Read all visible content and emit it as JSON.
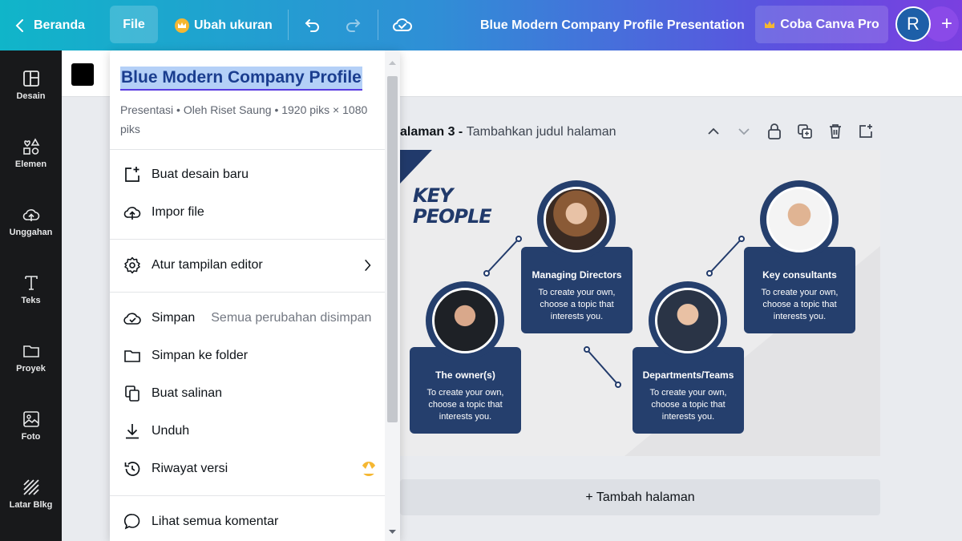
{
  "topbar": {
    "back_label": "Beranda",
    "file_label": "File",
    "resize_label": "Ubah ukuran",
    "doc_title": "Blue Modern Company Profile Presentation",
    "pro_label": "Coba Canva Pro",
    "avatar_initial": "R",
    "plus": "+"
  },
  "sidebar": {
    "items": [
      {
        "label": "Desain"
      },
      {
        "label": "Elemen"
      },
      {
        "label": "Unggahan"
      },
      {
        "label": "Teks"
      },
      {
        "label": "Proyek"
      },
      {
        "label": "Foto"
      },
      {
        "label": "Latar Blkg"
      }
    ]
  },
  "page": {
    "number_label": "alaman 3 -",
    "title_placeholder": "Tambahkan judul halaman",
    "add_page_label": "+ Tambah halaman"
  },
  "slide": {
    "heading_line1": "KEY",
    "heading_line2": "PEOPLE",
    "cards": [
      {
        "title": "Managing Directors",
        "desc": "To create your own, choose a topic that interests you."
      },
      {
        "title": "Key consultants",
        "desc": "To create your own, choose a topic that interests you."
      },
      {
        "title": "The owner(s)",
        "desc": "To create your own, choose a topic that interests you."
      },
      {
        "title": "Departments/Teams",
        "desc": "To create your own, choose a topic that interests you."
      }
    ]
  },
  "menu": {
    "title": "Blue Modern Company Profile",
    "meta": "Presentasi • Oleh Riset Saung • 1920 piks × 1080 piks",
    "items": [
      {
        "label": "Buat desain baru"
      },
      {
        "label": "Impor file"
      },
      {
        "label": "Atur tampilan editor"
      },
      {
        "label": "Simpan",
        "extra": "Semua perubahan disimpan"
      },
      {
        "label": "Simpan ke folder"
      },
      {
        "label": "Buat salinan"
      },
      {
        "label": "Unduh"
      },
      {
        "label": "Riwayat versi"
      },
      {
        "label": "Lihat semua komentar"
      }
    ]
  },
  "colors": {
    "accent_navy": "#253f6d",
    "crown": "#f5b731",
    "selection": "#b4d0f7"
  }
}
